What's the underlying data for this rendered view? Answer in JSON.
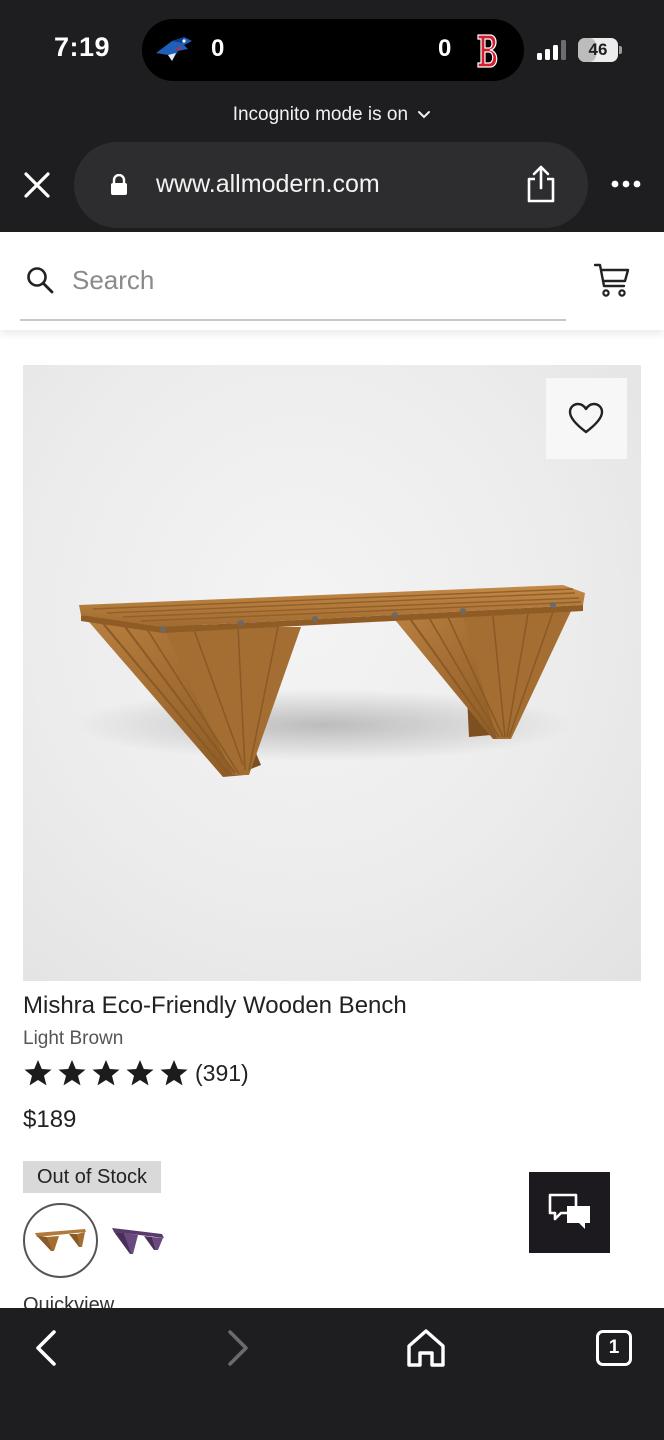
{
  "status_bar": {
    "time": "7:19",
    "live_activity": {
      "team_left_logo": "blue-jays-logo",
      "team_left_score": "0",
      "team_right_score": "0",
      "team_right_logo": "red-sox-logo"
    },
    "battery_level": "46",
    "battery_fraction": 0.46,
    "icons": [
      "signal-icon",
      "battery-icon"
    ]
  },
  "browser": {
    "incognito_label": "Incognito mode is on",
    "url": "www.allmodern.com",
    "icons": [
      "close-icon",
      "lock-icon",
      "share-icon",
      "more-icon"
    ]
  },
  "site": {
    "search_placeholder": "Search",
    "icons": [
      "search-icon",
      "cart-icon",
      "heart-icon",
      "chat-icon"
    ]
  },
  "product": {
    "title": "Mishra Eco-Friendly Wooden Bench",
    "variant": "Light Brown",
    "rating_stars": 5,
    "review_count": "(391)",
    "price": "$189",
    "stock_status": "Out of Stock",
    "swatches": [
      "light-brown-swatch",
      "purple-swatch"
    ],
    "quickview_label": "Quickview"
  },
  "toolbar": {
    "tab_count": "1",
    "icons": [
      "back-icon",
      "forward-icon",
      "home-icon",
      "tabs-icon"
    ]
  },
  "colors": {
    "chrome_bg": "#1e1e20",
    "wood": "#b07a3c",
    "wood_dark": "#8a5a26",
    "chat_button": "#1c1a1f",
    "badge_bg": "#d9d9d9"
  }
}
